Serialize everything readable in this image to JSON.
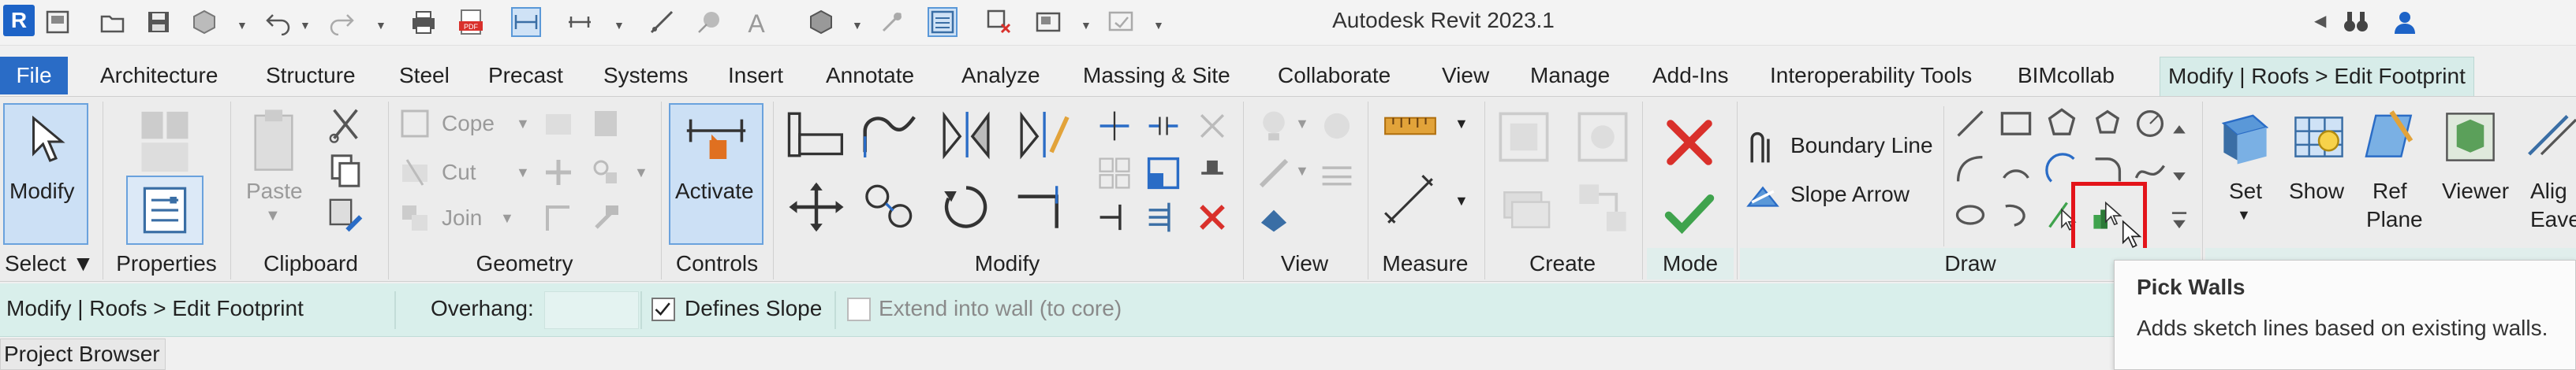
{
  "app": {
    "title": "Autodesk Revit 2023.1",
    "logo_letter": "R"
  },
  "qat": {
    "icons": [
      "open-icon",
      "save-icon",
      "sync-icon",
      "undo-icon",
      "redo-icon",
      "print-icon",
      "pdf-icon",
      "thin-lines-icon",
      "measure-icon",
      "dimension-icon",
      "tag-icon",
      "text-icon",
      "3d-view-icon",
      "section-icon",
      "switch-windows-icon",
      "close-inactive-icon",
      "window-tile-icon",
      "customize-icon"
    ],
    "right_icons": [
      "back-arrow-icon",
      "binoculars-icon",
      "user-icon"
    ]
  },
  "tabs": [
    "File",
    "Architecture",
    "Structure",
    "Steel",
    "Precast",
    "Systems",
    "Insert",
    "Annotate",
    "Analyze",
    "Massing & Site",
    "Collaborate",
    "View",
    "Manage",
    "Add-Ins",
    "Interoperability Tools",
    "BIMcollab",
    "Modify | Roofs > Edit Footprint"
  ],
  "panels": {
    "select": {
      "label": "Select",
      "modify_label": "Modify"
    },
    "properties": {
      "label": "Properties"
    },
    "clipboard": {
      "label": "Clipboard",
      "paste_label": "Paste"
    },
    "geometry": {
      "label": "Geometry",
      "cope": "Cope",
      "cut": "Cut",
      "join": "Join"
    },
    "controls": {
      "label": "Controls",
      "activate": "Activate"
    },
    "modify": {
      "label": "Modify"
    },
    "view": {
      "label": "View"
    },
    "measure": {
      "label": "Measure"
    },
    "create": {
      "label": "Create"
    },
    "mode": {
      "label": "Mode"
    },
    "draw": {
      "label": "Draw",
      "boundary_line": "Boundary Line",
      "slope_arrow": "Slope Arrow"
    },
    "workplane": {
      "set": "Set",
      "show": "Show",
      "ref_plane_1": "Ref",
      "ref_plane_2": "Plane",
      "viewer": "Viewer",
      "align_1": "Alig",
      "align_2": "Eave"
    }
  },
  "options_bar": {
    "context": "Modify | Roofs > Edit Footprint",
    "overhang_label": "Overhang:",
    "overhang_value": "",
    "defines_slope": "Defines Slope",
    "defines_slope_checked": true,
    "extend_into_wall": "Extend into wall (to core)",
    "extend_checked": false
  },
  "project_browser": {
    "label": "Project Browser"
  },
  "tooltip": {
    "title": "Pick Walls",
    "description": "Adds sketch lines based on existing walls."
  },
  "colors": {
    "file_tab": "#2a6cc6",
    "context_tab": "#d7ece9",
    "highlight": "#e3141a",
    "cancel_red": "#d9302b",
    "finish_green": "#3fa34d"
  }
}
